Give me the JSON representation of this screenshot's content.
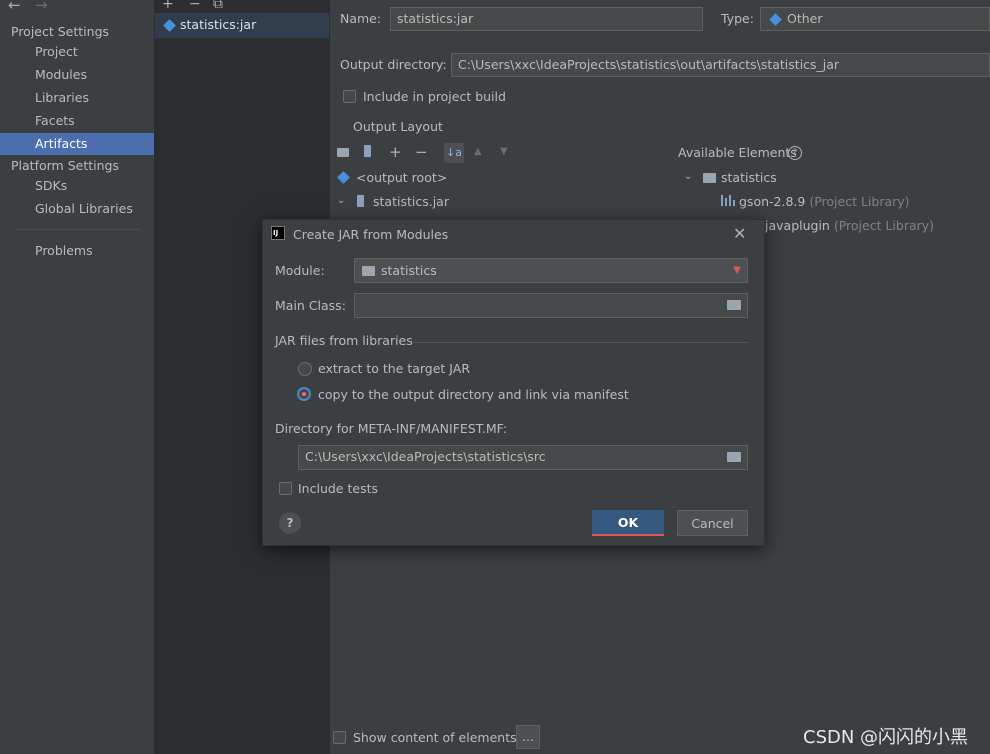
{
  "sidebar": {
    "toolbar": {
      "back": "←",
      "forward": "→"
    },
    "project_settings_header": "Project Settings",
    "project_items": [
      "Project",
      "Modules",
      "Libraries",
      "Facets",
      "Artifacts"
    ],
    "platform_settings_header": "Platform Settings",
    "platform_items": [
      "SDKs",
      "Global Libraries"
    ],
    "problems": "Problems",
    "selected": "Artifacts"
  },
  "artifacts": {
    "toolbar": {
      "add": "+",
      "remove": "−",
      "copy": "⧉"
    },
    "items": [
      "statistics:jar"
    ]
  },
  "config": {
    "name_label": "Name:",
    "name_value": "statistics:jar",
    "type_label": "Type:",
    "type_value": "Other",
    "output_dir_label": "Output directory:",
    "output_dir_value": "C:\\Users\\xxc\\IdeaProjects\\statistics\\out\\artifacts\\statistics_jar",
    "include_build_label": "Include in project build",
    "output_layout_label": "Output Layout",
    "layout_tree": [
      "<output root>",
      "statistics.jar"
    ],
    "available_elements_label": "Available Elements",
    "available_tree": {
      "module": "statistics",
      "libs": [
        {
          "name": "gson-2.8.9",
          "type": "(Project Library)"
        },
        {
          "name": "javaplugin",
          "type": "(Project Library)"
        }
      ]
    },
    "show_content_label": "Show content of elements",
    "ellipsis_button": "..."
  },
  "dialog": {
    "title": "Create JAR from Modules",
    "icon_text": "IJ",
    "module_label": "Module:",
    "module_value": "statistics",
    "main_class_label": "Main Class:",
    "main_class_value": "",
    "jar_files_label": "JAR files from libraries",
    "radio_extract": "extract to the target JAR",
    "radio_copy": "copy to the output directory and link via manifest",
    "radio_selected": "copy",
    "manifest_dir_label": "Directory for META-INF/MANIFEST.MF:",
    "manifest_dir_value": "C:\\Users\\xxc\\IdeaProjects\\statistics\\src",
    "include_tests_label": "Include tests",
    "help": "?",
    "ok": "OK",
    "cancel": "Cancel"
  },
  "colors": {
    "selection": "#4b6eaf",
    "ok_button": "#365880",
    "ok_underline": "#e05555",
    "dropdown_arrow": "#e05555",
    "diamond_icon": "#4a90d9"
  },
  "watermark": "CSDN @闪闪的小黑"
}
